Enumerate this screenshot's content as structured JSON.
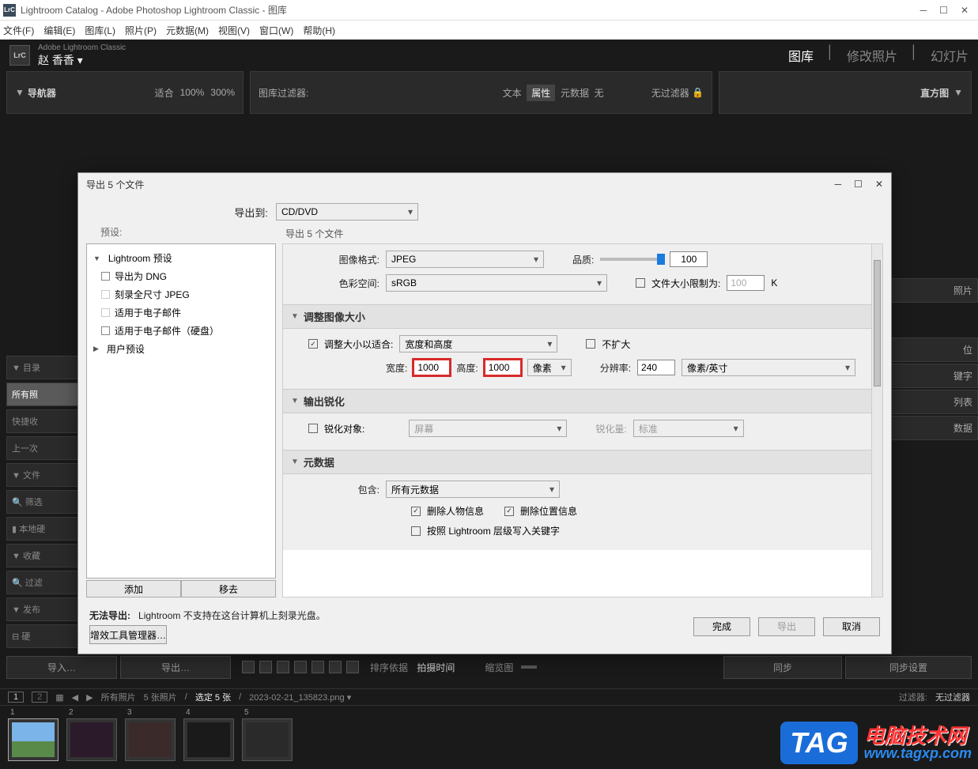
{
  "window": {
    "title": "Lightroom Catalog - Adobe Photoshop Lightroom Classic - 图库",
    "app_icon": "LrC"
  },
  "menu": [
    "文件(F)",
    "编辑(E)",
    "图库(L)",
    "照片(P)",
    "元数据(M)",
    "视图(V)",
    "窗口(W)",
    "帮助(H)"
  ],
  "header": {
    "badge": "LrC",
    "brand": "Adobe Lightroom Classic",
    "user": "赵 香香  ▾",
    "modules": {
      "library": "图库",
      "develop": "修改照片",
      "slideshow": "幻灯片"
    }
  },
  "nav_panel": {
    "title": "导航器",
    "fit": "适合",
    "z100": "100%",
    "z300": "300%"
  },
  "filter_bar": {
    "title": "图库过滤器:",
    "text": "文本",
    "attr": "属性",
    "meta": "元数据",
    "none": "无",
    "nofilter": "无过滤器"
  },
  "histogram": "直方图",
  "left_cats": {
    "catalog": "目录",
    "all": "所有照",
    "quick": "快捷收",
    "prev": "上一次",
    "files": "文件",
    "filter": "筛选",
    "local": "本地硬",
    "fav": "收藏",
    "filt2": "过滤",
    "publish": "发布",
    "hd": "硬"
  },
  "right_panels": [
    "照片",
    "键字",
    "列表",
    "数据",
    "位"
  ],
  "bottom": {
    "import": "导入…",
    "export": "导出…",
    "sort_label": "排序依据",
    "sort_value": "拍摄时间",
    "thumb_label": "缩览图",
    "sync": "同步",
    "sync_settings": "同步设置"
  },
  "film_bar": {
    "all": "所有照片",
    "count": "5 张照片",
    "selected": "选定 5 张",
    "filename": "2023-02-21_135823.png ▾",
    "filter_label": "过滤器:",
    "filter_value": "无过滤器"
  },
  "watermark": {
    "tag": "TAG",
    "text": "电脑技术网",
    "url": "www.tagxp.com"
  },
  "dialog": {
    "title": "导出 5 个文件",
    "export_to_label": "导出到:",
    "export_to_value": "CD/DVD",
    "presets_label": "预设:",
    "presets": {
      "lightroom_header": "Lightroom 预设",
      "dng": "导出为 DNG",
      "jpeg": "刻录全尺寸 JPEG",
      "email": "适用于电子邮件",
      "email_hd": "适用于电子邮件（硬盘）",
      "user_header": "用户预设"
    },
    "add_btn": "添加",
    "remove_btn": "移去",
    "settings_title": "导出 5 个文件",
    "image_format": {
      "label": "图像格式:",
      "value": "JPEG"
    },
    "quality": {
      "label": "品质:",
      "value": "100"
    },
    "color_space": {
      "label": "色彩空间:",
      "value": "sRGB"
    },
    "limit": {
      "label": "文件大小限制为:",
      "value": "100",
      "unit": "K"
    },
    "resize_section": "调整图像大小",
    "resize_fit": {
      "label": "调整大小以适合:",
      "value": "宽度和高度"
    },
    "dont_enlarge": "不扩大",
    "width": {
      "label": "宽度:",
      "value": "1000"
    },
    "height": {
      "label": "高度:",
      "value": "1000"
    },
    "pixels": "像素",
    "resolution": {
      "label": "分辨率:",
      "value": "240",
      "unit": "像素/英寸"
    },
    "sharpen_section": "输出锐化",
    "sharpen": {
      "label": "锐化对象:",
      "value": "屏幕"
    },
    "sharpen_amount": {
      "label": "锐化量:",
      "value": "标准"
    },
    "metadata_section": "元数据",
    "include": {
      "label": "包含:",
      "value": "所有元数据"
    },
    "remove_people": "删除人物信息",
    "remove_location": "删除位置信息",
    "hierarchy": "按照 Lightroom 层级写入关键字",
    "cannot_export_label": "无法导出:",
    "cannot_export_msg": "Lightroom 不支持在这台计算机上刻录光盘。",
    "plugin_mgr": "增效工具管理器…",
    "done": "完成",
    "export": "导出",
    "cancel": "取消"
  }
}
